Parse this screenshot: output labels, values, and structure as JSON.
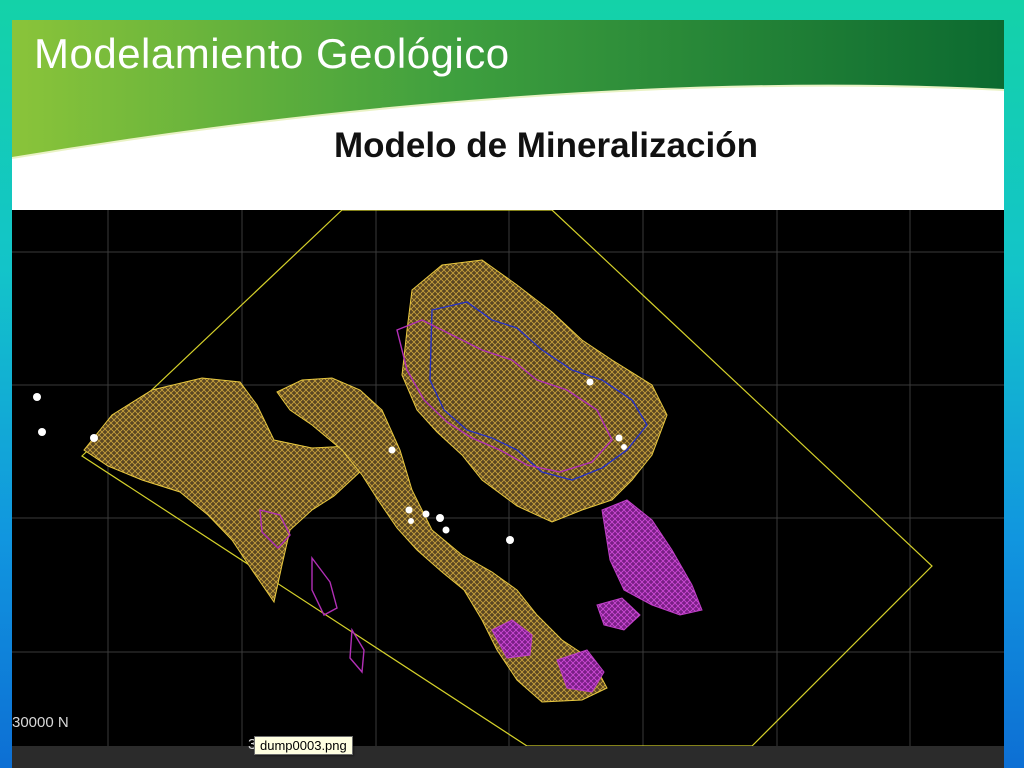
{
  "slide": {
    "title": "Modelamiento Geológico",
    "subtitle": "Modelo de Mineralización"
  },
  "plot": {
    "coordinate_label": "30000 N",
    "coordinate_fragment": "3",
    "tooltip": "dump0003.png",
    "colors": {
      "background": "#000000",
      "grid": "#3a3a3a",
      "boundary": "#d4d02a",
      "mineralization_low": "#c8a23c",
      "mineralization_high": "#b22fb6",
      "mineralization_blue": "#2430c4",
      "drillholes": "#ffffff"
    }
  }
}
